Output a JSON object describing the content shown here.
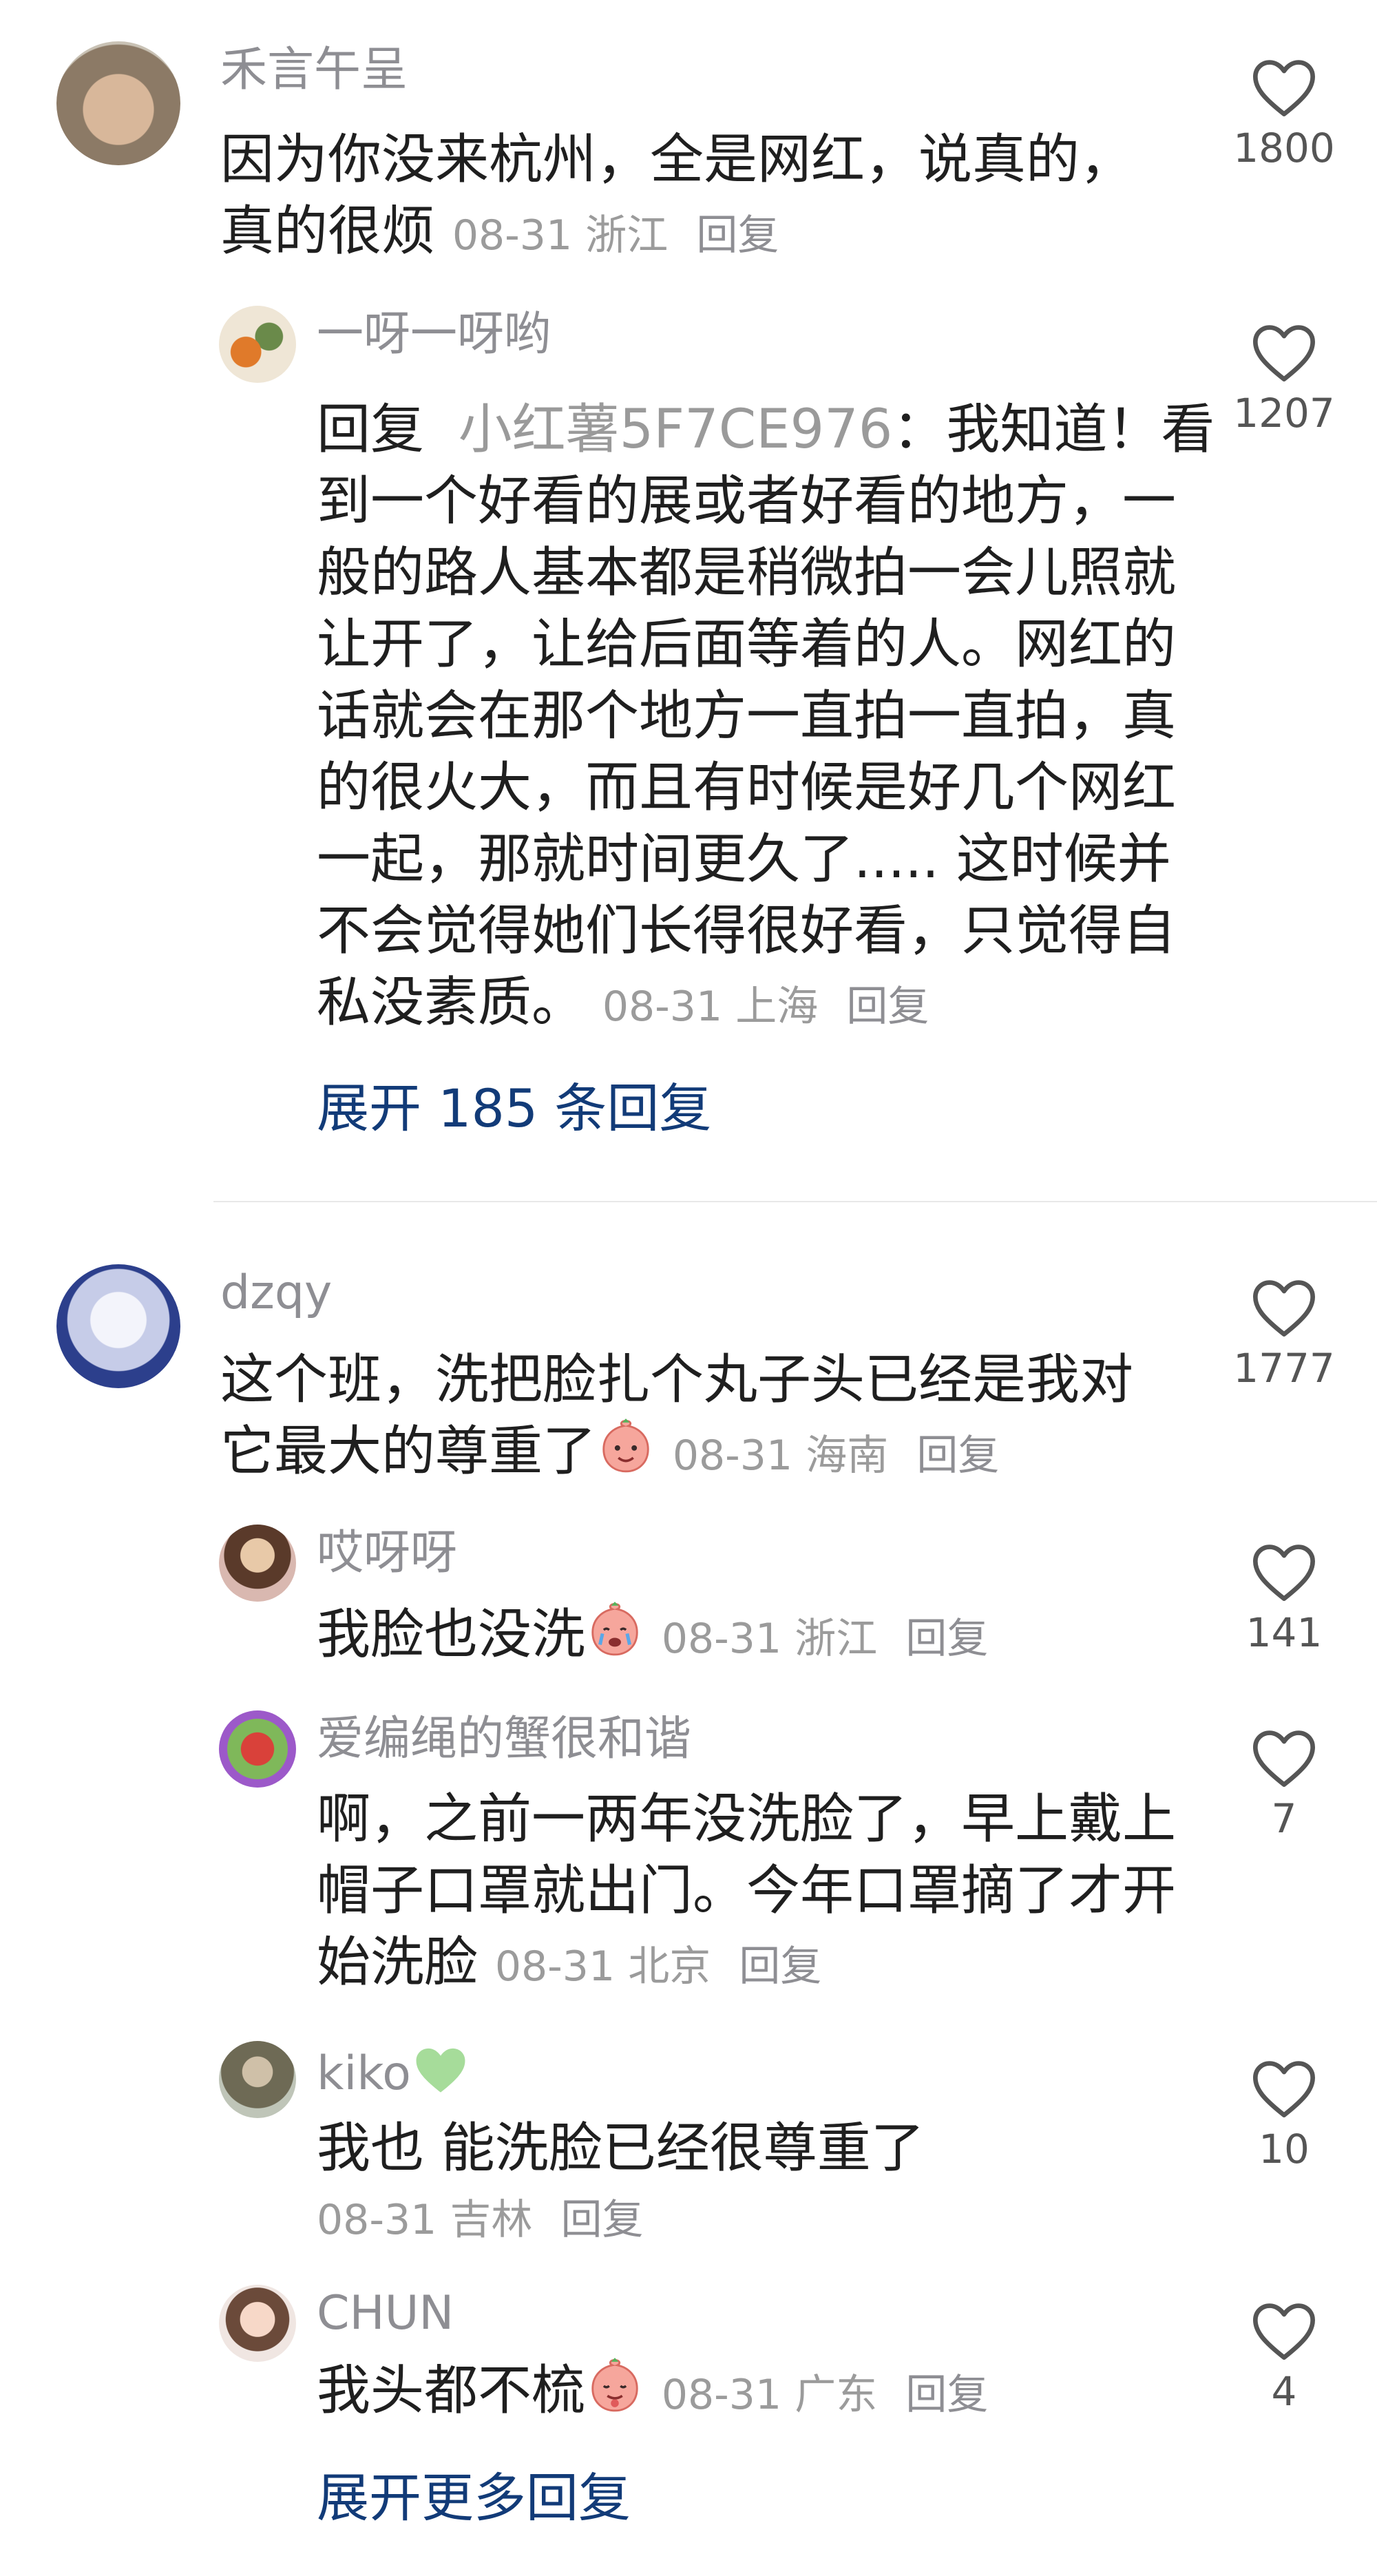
{
  "comments": [
    {
      "user": "禾言午呈",
      "text": "因为你没来杭州，全是网红，说真的，",
      "text2": "真的很烦",
      "date": "08-31",
      "location": "浙江",
      "reply_label": "回复",
      "likes": "1800",
      "replies": [
        {
          "user": "一呀一呀哟",
          "lines": [
            "到一个好看的展或者好看的地方，一",
            "般的路人基本都是稍微拍一会儿照就",
            "让开了，让给后面等着的人。网红的",
            "话就会在那个地方一直拍一直拍，真",
            "的很火大，而且有时候是好几个网红",
            "一起，那就时间更久了..... 这时候并",
            "不会觉得她们长得很好看，只觉得自"
          ],
          "prefix": "回复",
          "mention": "小红薯5F7CE976",
          "first_line_rest": "：我知道！看",
          "last_line": "私没素质。",
          "date": "08-31",
          "location": "上海",
          "reply_label": "回复",
          "likes": "1207"
        }
      ],
      "expand": "展开 185 条回复"
    },
    {
      "user": "dzqy",
      "text": "这个班，洗把脸扎个丸子头已经是我对",
      "text2": "它最大的尊重了",
      "date": "08-31",
      "location": "海南",
      "reply_label": "回复",
      "likes": "1777",
      "replies": [
        {
          "user": "哎呀呀",
          "text": "我脸也没洗",
          "date": "08-31",
          "location": "浙江",
          "reply_label": "回复",
          "likes": "141"
        },
        {
          "user": "爱编绳的蟹很和谐",
          "line1": "啊，之前一两年没洗脸了，早上戴上",
          "line2": "帽子口罩就出门。今年口罩摘了才开",
          "line3": "始洗脸",
          "date": "08-31",
          "location": "北京",
          "reply_label": "回复",
          "likes": "7"
        },
        {
          "user": "kiko",
          "text": "我也 能洗脸已经很尊重了",
          "date": "08-31",
          "location": "吉林",
          "reply_label": "回复",
          "likes": "10"
        },
        {
          "user": "CHUN",
          "text": "我头都不梳",
          "date": "08-31",
          "location": "广东",
          "reply_label": "回复",
          "likes": "4"
        }
      ],
      "expand": "展开更多回复"
    }
  ],
  "colors": {
    "link": "#123b78",
    "meta": "#9b9b9b",
    "name": "#8e8e93"
  },
  "icons": [
    "heart-outline-icon",
    "emoji-face-icon",
    "green-heart-icon"
  ]
}
